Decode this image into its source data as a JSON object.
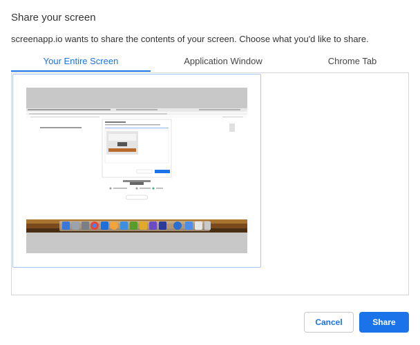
{
  "dialog": {
    "title": "Share your screen",
    "subtitle": "screenapp.io wants to share the contents of your screen. Choose what you'd like to share."
  },
  "tabs": [
    {
      "label": "Your Entire Screen",
      "active": true
    },
    {
      "label": "Application Window",
      "active": false
    },
    {
      "label": "Chrome Tab",
      "active": false
    }
  ],
  "colors": {
    "accent": "#1a73e8",
    "selection_border": "#a8c7f5",
    "content_border": "#d6d6d6"
  },
  "buttons": {
    "cancel_label": "Cancel",
    "share_label": "Share"
  }
}
